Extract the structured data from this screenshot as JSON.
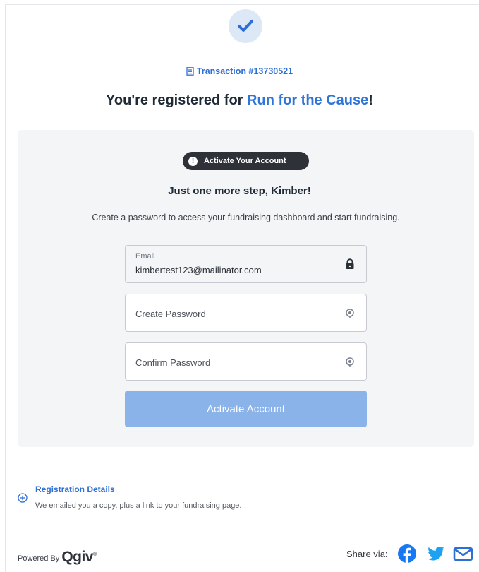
{
  "header": {
    "transaction_label": "Transaction #13730521",
    "headline_prefix": "You're registered for ",
    "event_name": "Run for the Cause",
    "headline_suffix": "!"
  },
  "activate": {
    "badge_label": "Activate Your Account",
    "title": "Just one more step, Kimber!",
    "description": "Create a password to access your fundraising dashboard and start fundraising.",
    "email_label": "Email",
    "email_value": "kimbertest123@mailinator.com",
    "create_password_placeholder": "Create Password",
    "confirm_password_placeholder": "Confirm Password",
    "button_label": "Activate Account"
  },
  "registration": {
    "title": "Registration Details",
    "description": "We emailed you a copy, plus a link to your fundraising page."
  },
  "footer": {
    "powered_by": "Powered By",
    "logo_text": "Qgiv",
    "logo_mark": "®",
    "share_label": "Share via:"
  },
  "colors": {
    "accent": "#2f74d9",
    "button_disabled": "#8ab3ea",
    "badge_bg": "#2e3238",
    "panel_bg": "#f4f5f7",
    "facebook": "#1877f2",
    "twitter": "#1da1f2",
    "email": "#2e6fd6"
  },
  "icons": {
    "success": "checkmark-icon",
    "transaction": "receipt-icon",
    "badge": "exclamation-icon",
    "lock": "lock-icon",
    "password_toggle": "eye-toggle-icon",
    "expand": "plus-circle-icon",
    "facebook": "facebook-icon",
    "twitter": "twitter-icon",
    "email": "envelope-icon"
  }
}
